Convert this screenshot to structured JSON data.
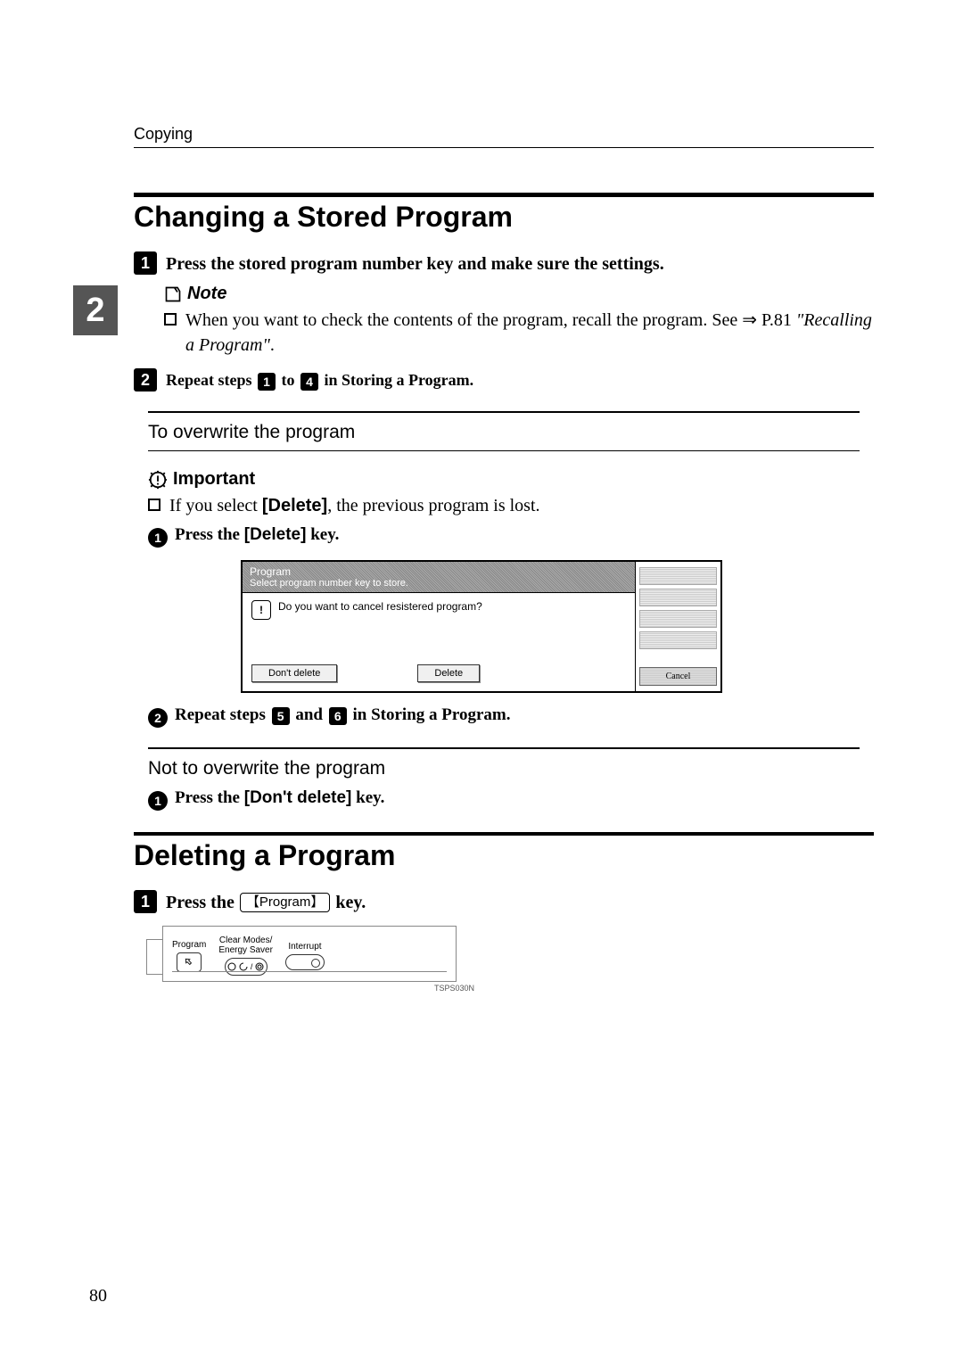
{
  "running_head": "Copying",
  "side_tab": "2",
  "page_number": "80",
  "section1": {
    "title": "Changing a Stored Program",
    "step1": "Press the stored program number key and make sure the settings.",
    "note_label": "Note",
    "note_body_prefix": "When you want to check the contents of the program, recall the program. See ",
    "note_arrow": "⇒",
    "note_ref": "P.81 ",
    "note_ref_italic": "\"Recalling a Program\"",
    "note_period": ".",
    "step2_prefix": "Repeat steps ",
    "step2_mid": " to ",
    "step2_suffix": " in Storing a Program.",
    "step2_badge_a": "1",
    "step2_badge_b": "4",
    "sub_overwrite": {
      "title": "To overwrite the program",
      "important_label": "Important",
      "important_body_prefix": "If you select ",
      "important_key": "[Delete]",
      "important_body_suffix": ", the previous program is lost.",
      "substep1_prefix": "Press the ",
      "substep1_key": "[Delete]",
      "substep1_suffix": " key.",
      "screenshot": {
        "header_line1": "Program",
        "header_line2": "Select program number key to store.",
        "prompt": "Do you want to cancel resistered program?",
        "btn_dont_delete": "Don't delete",
        "btn_delete": "Delete",
        "btn_cancel": "Cancel"
      },
      "substep2_prefix": "Repeat steps ",
      "substep2_mid": " and ",
      "substep2_suffix": " in Storing a Program.",
      "substep2_badge_a": "5",
      "substep2_badge_b": "6"
    },
    "sub_not_overwrite": {
      "title": "Not to overwrite the program",
      "substep1_prefix": "Press the ",
      "substep1_key": "[Don't delete]",
      "substep1_suffix": " key."
    }
  },
  "section2": {
    "title": "Deleting a Program",
    "step1_prefix": "Press the ",
    "step1_key": "Program",
    "step1_suffix": " key.",
    "keypanel": {
      "program": "Program",
      "clear_line1": "Clear Modes/",
      "clear_line2": "Energy Saver",
      "interrupt": "Interrupt",
      "fig_code": "TSPS030N"
    }
  }
}
